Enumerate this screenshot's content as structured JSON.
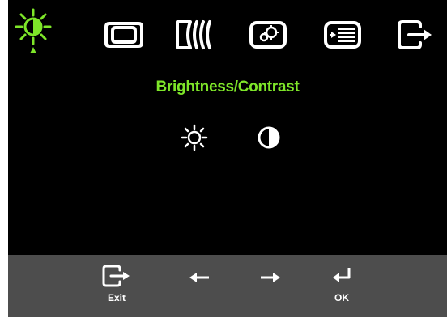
{
  "colors": {
    "accent": "#7ee629",
    "icon": "#ffffff",
    "background": "#000000",
    "footer": "#4d4d4d",
    "footer_text": "#ffffff"
  },
  "tabs": [
    {
      "icon": "brightness-sun-icon",
      "selected": true
    },
    {
      "icon": "image-position-icon",
      "selected": false
    },
    {
      "icon": "image-setup-icon",
      "selected": false
    },
    {
      "icon": "image-properties-icon",
      "selected": false
    },
    {
      "icon": "options-menu-icon",
      "selected": false
    },
    {
      "icon": "exit-tab-icon",
      "selected": false
    }
  ],
  "section": {
    "title": "Brightness/Contrast"
  },
  "sub_items": [
    {
      "icon": "brightness-icon"
    },
    {
      "icon": "contrast-icon"
    }
  ],
  "footer": {
    "exit": {
      "icon": "exit-icon",
      "label": "Exit"
    },
    "left": {
      "icon": "arrow-left-icon"
    },
    "right": {
      "icon": "arrow-right-icon"
    },
    "ok": {
      "icon": "enter-icon",
      "label": "OK"
    }
  }
}
